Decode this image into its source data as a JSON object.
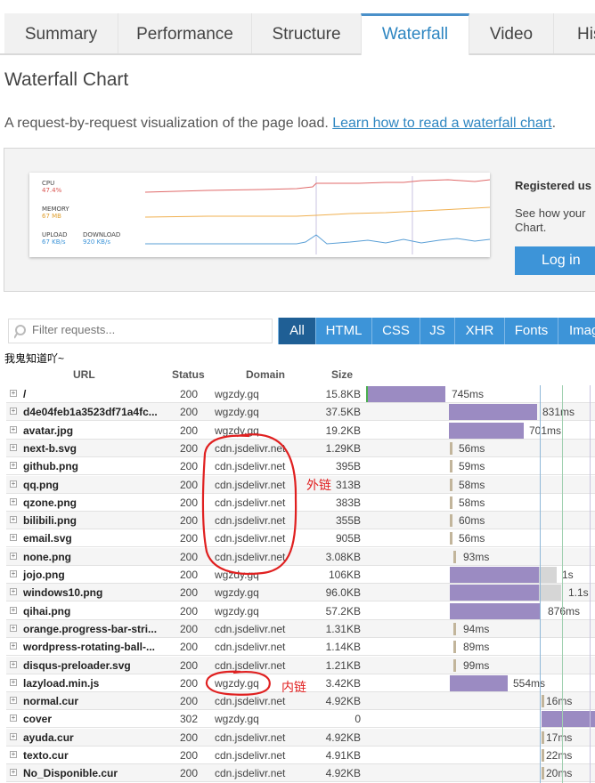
{
  "tabs": [
    "Summary",
    "Performance",
    "Structure",
    "Waterfall",
    "Video",
    "His"
  ],
  "active_tab": "Waterfall",
  "page_title": "Waterfall Chart",
  "intro": {
    "text": "A request-by-request visualization of the page load. ",
    "link": "Learn how to read a waterfall chart",
    "end": "."
  },
  "metrics": {
    "cpu_label": "CPU",
    "cpu_value": "47.4%",
    "memory_label": "MEMORY",
    "memory_value": "67 MB",
    "upload_label": "UPLOAD",
    "upload_value": "67 KB/s",
    "download_label": "DOWNLOAD",
    "download_value": "920 KB/s"
  },
  "sidebar": {
    "title": "Registered us",
    "text": "See how your Chart.",
    "login_label": "Log in"
  },
  "filter": {
    "placeholder": "Filter requests...",
    "tabs": [
      "All",
      "HTML",
      "CSS",
      "JS",
      "XHR",
      "Fonts",
      "Imag"
    ],
    "active": "All"
  },
  "note": "我鬼知道吖~",
  "columns": {
    "url": "URL",
    "status": "Status",
    "domain": "Domain",
    "size": "Size"
  },
  "rows": [
    {
      "url": "/",
      "status": "200",
      "domain": "wgzdy.gq",
      "size": "15.8KB",
      "time": "745ms"
    },
    {
      "url": "d4e04feb1a3523df71a4fc...",
      "status": "200",
      "domain": "wgzdy.gq",
      "size": "37.5KB",
      "time": "831ms"
    },
    {
      "url": "avatar.jpg",
      "status": "200",
      "domain": "wgzdy.gq",
      "size": "19.2KB",
      "time": "701ms"
    },
    {
      "url": "next-b.svg",
      "status": "200",
      "domain": "cdn.jsdelivr.net",
      "size": "1.29KB",
      "time": "56ms"
    },
    {
      "url": "github.png",
      "status": "200",
      "domain": "cdn.jsdelivr.net",
      "size": "395B",
      "time": "59ms"
    },
    {
      "url": "qq.png",
      "status": "200",
      "domain": "cdn.jsdelivr.net",
      "size": "313B",
      "time": "58ms"
    },
    {
      "url": "qzone.png",
      "status": "200",
      "domain": "cdn.jsdelivr.net",
      "size": "383B",
      "time": "58ms"
    },
    {
      "url": "bilibili.png",
      "status": "200",
      "domain": "cdn.jsdelivr.net",
      "size": "355B",
      "time": "60ms"
    },
    {
      "url": "email.svg",
      "status": "200",
      "domain": "cdn.jsdelivr.net",
      "size": "905B",
      "time": "56ms"
    },
    {
      "url": "none.png",
      "status": "200",
      "domain": "cdn.jsdelivr.net",
      "size": "3.08KB",
      "time": "93ms"
    },
    {
      "url": "jojo.png",
      "status": "200",
      "domain": "wgzdy.gq",
      "size": "106KB",
      "time": "1s"
    },
    {
      "url": "windows10.png",
      "status": "200",
      "domain": "wgzdy.gq",
      "size": "96.0KB",
      "time": "1.1s"
    },
    {
      "url": "qihai.png",
      "status": "200",
      "domain": "wgzdy.gq",
      "size": "57.2KB",
      "time": "876ms"
    },
    {
      "url": "orange.progress-bar-stri...",
      "status": "200",
      "domain": "cdn.jsdelivr.net",
      "size": "1.31KB",
      "time": "94ms"
    },
    {
      "url": "wordpress-rotating-ball-...",
      "status": "200",
      "domain": "cdn.jsdelivr.net",
      "size": "1.14KB",
      "time": "89ms"
    },
    {
      "url": "disqus-preloader.svg",
      "status": "200",
      "domain": "cdn.jsdelivr.net",
      "size": "1.21KB",
      "time": "99ms"
    },
    {
      "url": "lazyload.min.js",
      "status": "200",
      "domain": "wgzdy.gq",
      "size": "3.42KB",
      "time": "554ms"
    },
    {
      "url": "normal.cur",
      "status": "200",
      "domain": "cdn.jsdelivr.net",
      "size": "4.92KB",
      "time": "16ms"
    },
    {
      "url": "cover",
      "status": "302",
      "domain": "wgzdy.gq",
      "size": "0",
      "time": ""
    },
    {
      "url": "ayuda.cur",
      "status": "200",
      "domain": "cdn.jsdelivr.net",
      "size": "4.92KB",
      "time": "17ms"
    },
    {
      "url": "texto.cur",
      "status": "200",
      "domain": "cdn.jsdelivr.net",
      "size": "4.91KB",
      "time": "22ms"
    },
    {
      "url": "No_Disponible.cur",
      "status": "200",
      "domain": "cdn.jsdelivr.net",
      "size": "4.92KB",
      "time": "20ms"
    }
  ],
  "annotations": {
    "external": "外链",
    "internal": "内链"
  },
  "colors": {
    "accent": "#3d94d8",
    "bar": "#9b8bc2",
    "annotation": "#e02020"
  }
}
